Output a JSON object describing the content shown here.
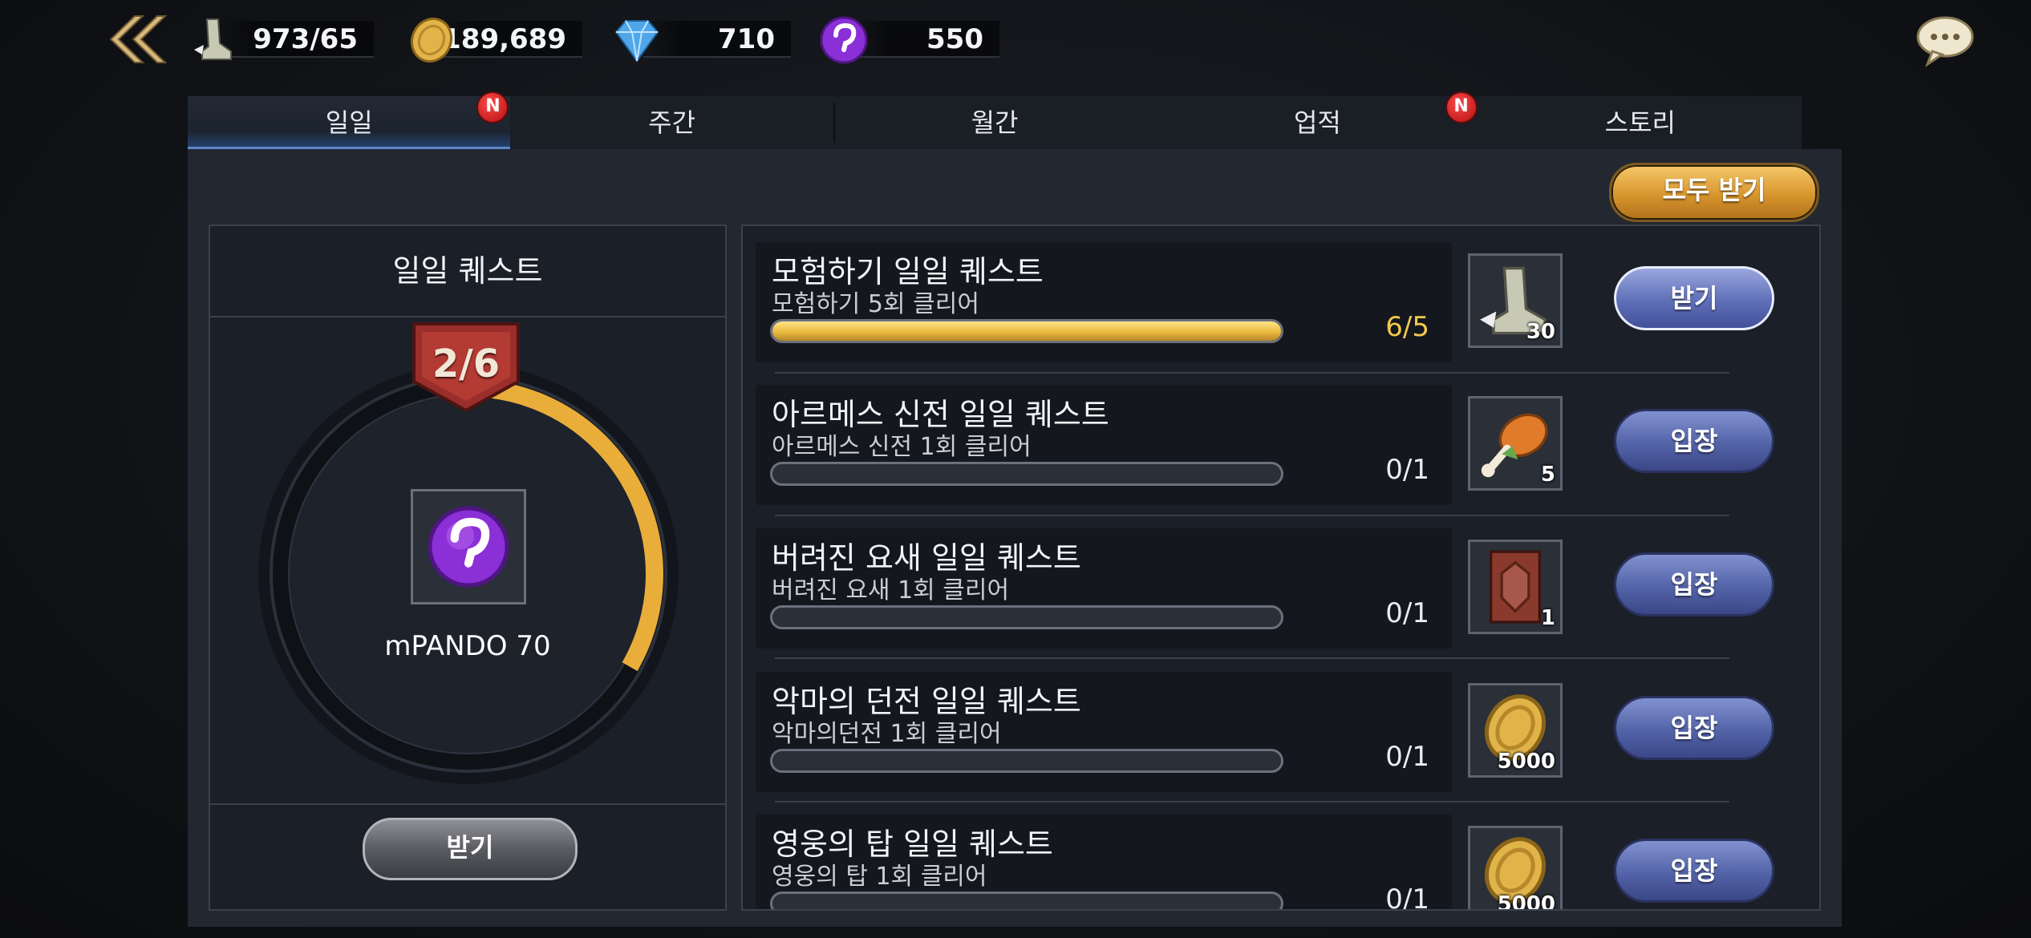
{
  "resources": [
    {
      "icon": "winged-boot-icon",
      "value": "973/65"
    },
    {
      "icon": "gold-coin-icon",
      "value": "189,689"
    },
    {
      "icon": "diamond-icon",
      "value": "710"
    },
    {
      "icon": "pando-icon",
      "value": "550"
    }
  ],
  "tabs": [
    {
      "label": "일일",
      "badge": "N"
    },
    {
      "label": "주간",
      "badge": ""
    },
    {
      "label": "월간",
      "badge": ""
    },
    {
      "label": "업적",
      "badge": "N"
    },
    {
      "label": "스토리",
      "badge": ""
    }
  ],
  "claim_all_label": "모두 받기",
  "daily": {
    "title": "일일 퀘스트",
    "stage": "2/6",
    "stage_progress": 0.333,
    "reward_label": "mPANDO 70",
    "claim_label": "받기"
  },
  "quests": [
    {
      "title": "모험하기 일일 퀘스트",
      "subtitle": "모험하기 5회 클리어",
      "progress": "6/5",
      "fraction": 1.0,
      "reward_icon": "winged-boot-icon",
      "reward_count": "30",
      "button": "받기"
    },
    {
      "title": "아르메스 신전 일일 퀘스트",
      "subtitle": "아르메스 신전 1회 클리어",
      "progress": "0/1",
      "fraction": 0.0,
      "reward_icon": "drumstick-icon",
      "reward_count": "5",
      "button": "입장"
    },
    {
      "title": "버려진 요새 일일 퀘스트",
      "subtitle": "버려진 요새 1회 클리어",
      "progress": "0/1",
      "fraction": 0.0,
      "reward_icon": "armor-card-icon",
      "reward_count": "1",
      "button": "입장"
    },
    {
      "title": "악마의 던전 일일 퀘스트",
      "subtitle": "악마의던전 1회 클리어",
      "progress": "0/1",
      "fraction": 0.0,
      "reward_icon": "gold-coin-icon",
      "reward_count": "5000",
      "button": "입장"
    },
    {
      "title": "영웅의 탑 일일 퀘스트",
      "subtitle": "영웅의 탑 1회 클리어",
      "progress": "0/1",
      "fraction": 0.0,
      "reward_icon": "gold-coin-icon",
      "reward_count": "5000",
      "button": "입장"
    }
  ],
  "colors": {
    "accent_gold": "#e9b93c",
    "button_blue": "#5363a8",
    "tab_active_line": "#5d86c6"
  }
}
